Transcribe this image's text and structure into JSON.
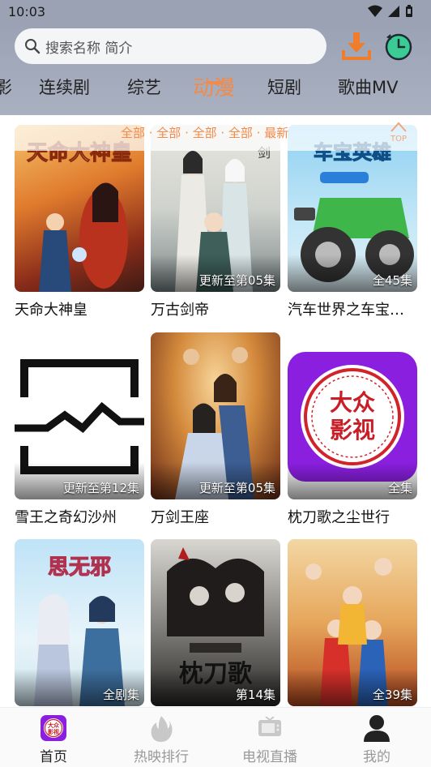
{
  "status_bar": {
    "time": "10:03"
  },
  "search": {
    "placeholder": "搜索名称 简介"
  },
  "categories": [
    {
      "label": "影"
    },
    {
      "label": "连续剧"
    },
    {
      "label": "综艺"
    },
    {
      "label": "动漫"
    },
    {
      "label": "短剧"
    },
    {
      "label": "歌曲MV"
    }
  ],
  "active_category": "动漫",
  "filter": {
    "text": "全部 · 全部 · 全部 · 全部 · 最新",
    "top_label": "TOP"
  },
  "items": [
    {
      "title": "天命大神皇",
      "badge": "",
      "poster_text": "天命大神皇"
    },
    {
      "title": "万古剑帝",
      "badge": "更新至第05集",
      "poster_text": ""
    },
    {
      "title": "汽车世界之车宝…",
      "badge": "全45集",
      "poster_text": "车宝英雄"
    },
    {
      "title": "雪王之奇幻沙州",
      "badge": "更新至第12集",
      "poster_text": ""
    },
    {
      "title": "万剑王座",
      "badge": "更新至第05集",
      "poster_text": ""
    },
    {
      "title": "枕刀歌之尘世行",
      "badge": "全集",
      "poster_text": "大众影视"
    },
    {
      "title": "",
      "badge": "全剧集",
      "poster_text": "思无邪"
    },
    {
      "title": "",
      "badge": "第14集",
      "poster_text": "枕刀歌"
    },
    {
      "title": "",
      "badge": "全39集",
      "poster_text": ""
    }
  ],
  "bottom_nav": [
    {
      "label": "首页",
      "icon": "home-logo-icon"
    },
    {
      "label": "热映排行",
      "icon": "fire-icon"
    },
    {
      "label": "电视直播",
      "icon": "tv-icon"
    },
    {
      "label": "我的",
      "icon": "user-icon"
    }
  ],
  "colors": {
    "accent": "#f28a49",
    "header_bg": "#9aa2b4"
  }
}
